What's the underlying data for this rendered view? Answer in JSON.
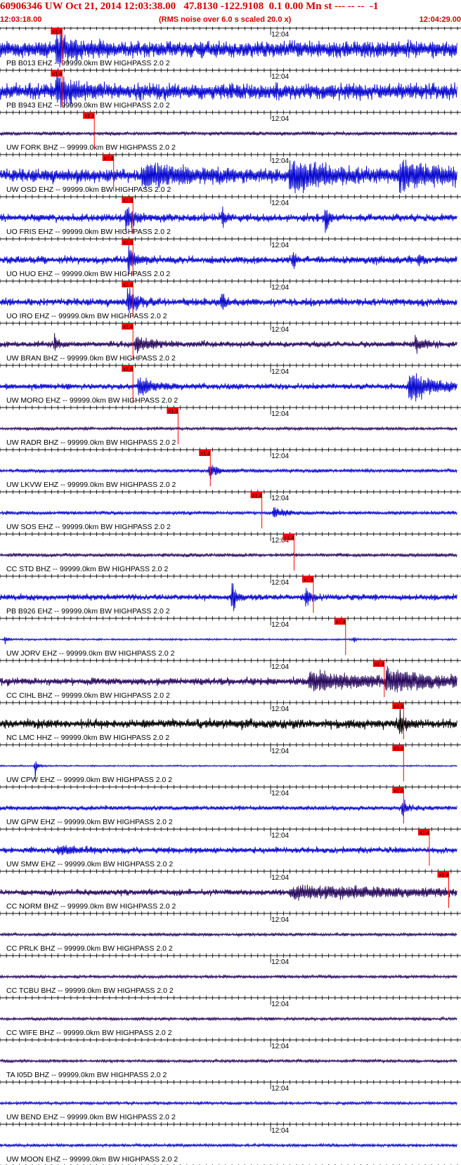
{
  "header": {
    "title": "60906346 UW Oct 21, 2014 12:03:38.00   47.8130 -122.9108  0.1 0.00 Mn st --- -- --  -1",
    "start_time": "12:03:18.00",
    "scale_note": "(RMS noise over 6.0 s scaled 20.0 x)",
    "end_time": "12:04:29.00"
  },
  "chart_data": {
    "type": "line",
    "x_start": "12:03:18.00",
    "x_end": "12:04:29.00",
    "x_range_seconds": [
      0,
      71
    ],
    "minute_label": "12:04",
    "minute_label_second": 42,
    "tick_seconds": 1,
    "pick_label": "x1.4",
    "trace_colors": {
      "blue": "#0a0ad0",
      "dark": "#2a0a5e",
      "black": "#000000"
    },
    "pick_color": "#ff0000",
    "traces": [
      {
        "label": "PB B013 EHZ -- 99999.0km BW  HIGHPASS  2.0  2",
        "color": "blue",
        "pick_seconds": 8.0,
        "amp": 0.55,
        "bursts": [
          [
            8.8,
            2.4,
            1.0
          ]
        ],
        "env_noise": 0.06
      },
      {
        "label": "PB B943 EHZ -- 99999.0km BW  HIGHPASS  2.0  2",
        "color": "blue",
        "pick_seconds": 8.0,
        "amp": 0.55,
        "bursts": [
          [
            8.8,
            2.4,
            1.0
          ]
        ],
        "env_noise": 0.06
      },
      {
        "label": "UW FORK BHZ -- 99999.0km BW  HIGHPASS  2.0  2",
        "color": "dark",
        "pick_seconds": 13.0,
        "amp": 0.12,
        "bursts": [],
        "env_noise": 0.3
      },
      {
        "label": "UW OSD EHZ -- 99999.0km BW  HIGHPASS  2.0  2",
        "color": "blue",
        "pick_seconds": 16.0,
        "amp": 0.45,
        "bursts": [
          [
            22,
            8,
            0.6
          ],
          [
            45,
            6,
            0.9
          ],
          [
            62,
            6,
            0.8
          ]
        ],
        "env_noise": 0.35
      },
      {
        "label": "UO FRIS EHZ -- 99999.0km BW  HIGHPASS  2.0  2",
        "color": "blue",
        "pick_seconds": 19.0,
        "amp": 0.25,
        "bursts": [
          [
            19.5,
            1.0,
            1.0
          ],
          [
            34.5,
            0.4,
            0.8
          ],
          [
            50.5,
            0.5,
            1.0
          ]
        ],
        "env_noise": 0.45
      },
      {
        "label": "UO HUO EHZ -- 99999.0km BW  HIGHPASS  2.0  2",
        "color": "blue",
        "pick_seconds": 19.0,
        "amp": 0.25,
        "bursts": [
          [
            20.0,
            1.0,
            1.0
          ],
          [
            45.5,
            0.4,
            0.7
          ],
          [
            65.0,
            0.4,
            0.7
          ]
        ],
        "env_noise": 0.45
      },
      {
        "label": "UO IRO EHZ -- 99999.0km BW  HIGHPASS  2.0  2",
        "color": "blue",
        "pick_seconds": 19.0,
        "amp": 0.25,
        "bursts": [
          [
            19.8,
            1.2,
            1.0
          ],
          [
            34.5,
            0.4,
            1.0
          ]
        ],
        "env_noise": 0.45
      },
      {
        "label": "UW BRAN BHZ -- 99999.0km BW  HIGHPASS  2.0  2",
        "color": "dark",
        "pick_seconds": 19.0,
        "amp": 0.2,
        "bursts": [
          [
            8.5,
            0.6,
            0.6
          ],
          [
            21.0,
            2.0,
            0.6
          ],
          [
            64.5,
            1.2,
            0.5
          ]
        ],
        "env_noise": 0.4
      },
      {
        "label": "UW MORO EHZ -- 99999.0km BW  HIGHPASS  2.0  2",
        "color": "blue",
        "pick_seconds": 19.0,
        "amp": 0.2,
        "bursts": [
          [
            21.5,
            2.0,
            0.7
          ],
          [
            63.5,
            3.5,
            1.0
          ]
        ],
        "env_noise": 0.4
      },
      {
        "label": "UW RADR BHZ -- 99999.0km BW  HIGHPASS  2.0  2",
        "color": "dark",
        "pick_seconds": 26.0,
        "amp": 0.1,
        "bursts": [],
        "env_noise": 0.3
      },
      {
        "label": "UW LKVW EHZ -- 99999.0km BW  HIGHPASS  2.0  2",
        "color": "blue",
        "pick_seconds": 31.0,
        "amp": 0.12,
        "bursts": [
          [
            32.5,
            1.2,
            0.5
          ]
        ],
        "env_noise": 0.3
      },
      {
        "label": "UW SOS EHZ -- 99999.0km BW  HIGHPASS  2.0  2",
        "color": "blue",
        "pick_seconds": 39.0,
        "amp": 0.12,
        "bursts": [
          [
            42.5,
            2.0,
            0.3
          ]
        ],
        "env_noise": 0.3
      },
      {
        "label": "CC STD BHZ -- 99999.0km BW  HIGHPASS  2.0  2",
        "color": "dark",
        "pick_seconds": 44.0,
        "amp": 0.12,
        "bursts": [],
        "env_noise": 0.3
      },
      {
        "label": "PB B926 EHZ -- 99999.0km BW  HIGHPASS  2.0  2",
        "color": "blue",
        "pick_seconds": 47.0,
        "amp": 0.2,
        "bursts": [
          [
            36.0,
            0.6,
            1.0
          ],
          [
            47.5,
            0.6,
            0.8
          ]
        ],
        "env_noise": 0.35
      },
      {
        "label": "UW JORV EHZ -- 99999.0km BW  HIGHPASS  2.0  2",
        "color": "blue",
        "pick_seconds": 52.0,
        "amp": 0.06,
        "bursts": [
          [
            0.8,
            0.4,
            0.3
          ],
          [
            55.0,
            0.3,
            0.2
          ]
        ],
        "env_noise": 0.2
      },
      {
        "label": "CC CIHL BHZ -- 99999.0km BW  HIGHPASS  2.0  2",
        "color": "dark",
        "pick_seconds": 58.0,
        "amp": 0.25,
        "bursts": [
          [
            48,
            10,
            0.6
          ],
          [
            60,
            6,
            0.7
          ]
        ],
        "env_noise": 0.3
      },
      {
        "label": "NC LMC HHZ -- 99999.0km BW  HIGHPASS  2.0  2",
        "color": "black",
        "pick_seconds": 61.0,
        "amp": 0.3,
        "bursts": [
          [
            62.0,
            0.8,
            0.8
          ]
        ],
        "env_noise": 0.6
      },
      {
        "label": "UW CPW EHZ -- 99999.0km BW  HIGHPASS  2.0  2",
        "color": "blue",
        "pick_seconds": 61.0,
        "amp": 0.05,
        "bursts": [
          [
            5.5,
            0.3,
            0.8
          ]
        ],
        "env_noise": 0.1
      },
      {
        "label": "UW GPW EHZ -- 99999.0km BW  HIGHPASS  2.0  2",
        "color": "blue",
        "pick_seconds": 61.0,
        "amp": 0.15,
        "bursts": [
          [
            62.5,
            0.6,
            0.7
          ]
        ],
        "env_noise": 0.3
      },
      {
        "label": "UW SMW EHZ -- 99999.0km BW  HIGHPASS  2.0  2",
        "color": "blue",
        "pick_seconds": 65.0,
        "amp": 0.2,
        "bursts": [
          [
            9,
            3,
            0.3
          ]
        ],
        "env_noise": 0.35
      },
      {
        "label": "CC NORM BHZ -- 99999.0km BW  HIGHPASS  2.0  2",
        "color": "dark",
        "pick_seconds": 68.0,
        "amp": 0.2,
        "bursts": [
          [
            45,
            20,
            0.4
          ]
        ],
        "env_noise": 0.3
      },
      {
        "label": "CC PRLK BHZ -- 99999.0km BW  HIGHPASS  2.0  2",
        "color": "dark",
        "pick_seconds": null,
        "amp": 0.1,
        "bursts": [],
        "env_noise": 0.25
      },
      {
        "label": "CC TCBU BHZ -- 99999.0km BW  HIGHPASS  2.0  2",
        "color": "dark",
        "pick_seconds": null,
        "amp": 0.1,
        "bursts": [],
        "env_noise": 0.25
      },
      {
        "label": "CC WIFE BHZ -- 99999.0km BW  HIGHPASS  2.0  2",
        "color": "dark",
        "pick_seconds": null,
        "amp": 0.1,
        "bursts": [],
        "env_noise": 0.25
      },
      {
        "label": "TA I05D BHZ -- 99999.0km BW  HIGHPASS  2.0  2",
        "color": "dark",
        "pick_seconds": null,
        "amp": 0.1,
        "bursts": [],
        "env_noise": 0.25
      },
      {
        "label": "UW BEND EHZ -- 99999.0km BW  HIGHPASS  2.0  2",
        "color": "blue",
        "pick_seconds": null,
        "amp": 0.1,
        "bursts": [],
        "env_noise": 0.25
      },
      {
        "label": "UW MOON EHZ -- 99999.0km BW  HIGHPASS  2.0  2",
        "color": "blue",
        "pick_seconds": null,
        "amp": 0.1,
        "bursts": [],
        "env_noise": 0.25
      }
    ]
  }
}
